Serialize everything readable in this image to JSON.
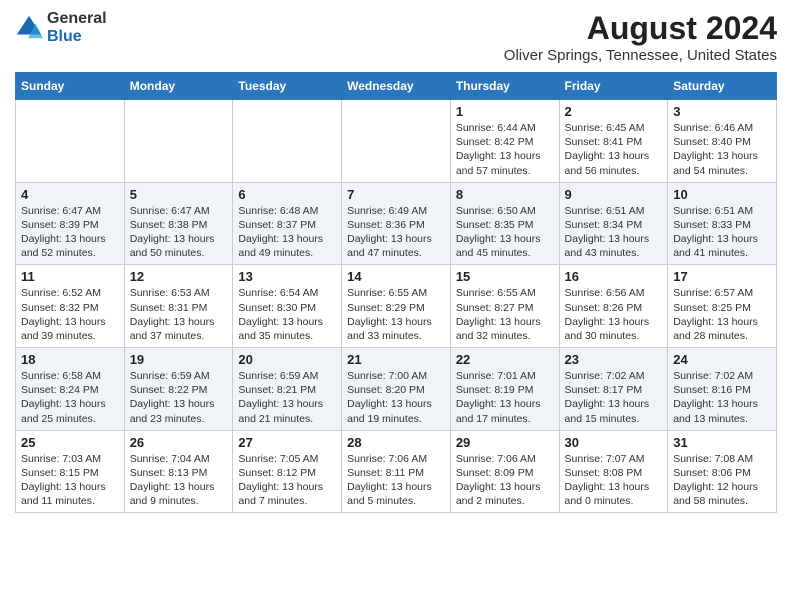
{
  "header": {
    "logo_line1": "General",
    "logo_line2": "Blue",
    "month_year": "August 2024",
    "location": "Oliver Springs, Tennessee, United States"
  },
  "days_of_week": [
    "Sunday",
    "Monday",
    "Tuesday",
    "Wednesday",
    "Thursday",
    "Friday",
    "Saturday"
  ],
  "weeks": [
    [
      {
        "day": "",
        "info": ""
      },
      {
        "day": "",
        "info": ""
      },
      {
        "day": "",
        "info": ""
      },
      {
        "day": "",
        "info": ""
      },
      {
        "day": "1",
        "info": "Sunrise: 6:44 AM\nSunset: 8:42 PM\nDaylight: 13 hours\nand 57 minutes."
      },
      {
        "day": "2",
        "info": "Sunrise: 6:45 AM\nSunset: 8:41 PM\nDaylight: 13 hours\nand 56 minutes."
      },
      {
        "day": "3",
        "info": "Sunrise: 6:46 AM\nSunset: 8:40 PM\nDaylight: 13 hours\nand 54 minutes."
      }
    ],
    [
      {
        "day": "4",
        "info": "Sunrise: 6:47 AM\nSunset: 8:39 PM\nDaylight: 13 hours\nand 52 minutes."
      },
      {
        "day": "5",
        "info": "Sunrise: 6:47 AM\nSunset: 8:38 PM\nDaylight: 13 hours\nand 50 minutes."
      },
      {
        "day": "6",
        "info": "Sunrise: 6:48 AM\nSunset: 8:37 PM\nDaylight: 13 hours\nand 49 minutes."
      },
      {
        "day": "7",
        "info": "Sunrise: 6:49 AM\nSunset: 8:36 PM\nDaylight: 13 hours\nand 47 minutes."
      },
      {
        "day": "8",
        "info": "Sunrise: 6:50 AM\nSunset: 8:35 PM\nDaylight: 13 hours\nand 45 minutes."
      },
      {
        "day": "9",
        "info": "Sunrise: 6:51 AM\nSunset: 8:34 PM\nDaylight: 13 hours\nand 43 minutes."
      },
      {
        "day": "10",
        "info": "Sunrise: 6:51 AM\nSunset: 8:33 PM\nDaylight: 13 hours\nand 41 minutes."
      }
    ],
    [
      {
        "day": "11",
        "info": "Sunrise: 6:52 AM\nSunset: 8:32 PM\nDaylight: 13 hours\nand 39 minutes."
      },
      {
        "day": "12",
        "info": "Sunrise: 6:53 AM\nSunset: 8:31 PM\nDaylight: 13 hours\nand 37 minutes."
      },
      {
        "day": "13",
        "info": "Sunrise: 6:54 AM\nSunset: 8:30 PM\nDaylight: 13 hours\nand 35 minutes."
      },
      {
        "day": "14",
        "info": "Sunrise: 6:55 AM\nSunset: 8:29 PM\nDaylight: 13 hours\nand 33 minutes."
      },
      {
        "day": "15",
        "info": "Sunrise: 6:55 AM\nSunset: 8:27 PM\nDaylight: 13 hours\nand 32 minutes."
      },
      {
        "day": "16",
        "info": "Sunrise: 6:56 AM\nSunset: 8:26 PM\nDaylight: 13 hours\nand 30 minutes."
      },
      {
        "day": "17",
        "info": "Sunrise: 6:57 AM\nSunset: 8:25 PM\nDaylight: 13 hours\nand 28 minutes."
      }
    ],
    [
      {
        "day": "18",
        "info": "Sunrise: 6:58 AM\nSunset: 8:24 PM\nDaylight: 13 hours\nand 25 minutes."
      },
      {
        "day": "19",
        "info": "Sunrise: 6:59 AM\nSunset: 8:22 PM\nDaylight: 13 hours\nand 23 minutes."
      },
      {
        "day": "20",
        "info": "Sunrise: 6:59 AM\nSunset: 8:21 PM\nDaylight: 13 hours\nand 21 minutes."
      },
      {
        "day": "21",
        "info": "Sunrise: 7:00 AM\nSunset: 8:20 PM\nDaylight: 13 hours\nand 19 minutes."
      },
      {
        "day": "22",
        "info": "Sunrise: 7:01 AM\nSunset: 8:19 PM\nDaylight: 13 hours\nand 17 minutes."
      },
      {
        "day": "23",
        "info": "Sunrise: 7:02 AM\nSunset: 8:17 PM\nDaylight: 13 hours\nand 15 minutes."
      },
      {
        "day": "24",
        "info": "Sunrise: 7:02 AM\nSunset: 8:16 PM\nDaylight: 13 hours\nand 13 minutes."
      }
    ],
    [
      {
        "day": "25",
        "info": "Sunrise: 7:03 AM\nSunset: 8:15 PM\nDaylight: 13 hours\nand 11 minutes."
      },
      {
        "day": "26",
        "info": "Sunrise: 7:04 AM\nSunset: 8:13 PM\nDaylight: 13 hours\nand 9 minutes."
      },
      {
        "day": "27",
        "info": "Sunrise: 7:05 AM\nSunset: 8:12 PM\nDaylight: 13 hours\nand 7 minutes."
      },
      {
        "day": "28",
        "info": "Sunrise: 7:06 AM\nSunset: 8:11 PM\nDaylight: 13 hours\nand 5 minutes."
      },
      {
        "day": "29",
        "info": "Sunrise: 7:06 AM\nSunset: 8:09 PM\nDaylight: 13 hours\nand 2 minutes."
      },
      {
        "day": "30",
        "info": "Sunrise: 7:07 AM\nSunset: 8:08 PM\nDaylight: 13 hours\nand 0 minutes."
      },
      {
        "day": "31",
        "info": "Sunrise: 7:08 AM\nSunset: 8:06 PM\nDaylight: 12 hours\nand 58 minutes."
      }
    ]
  ]
}
